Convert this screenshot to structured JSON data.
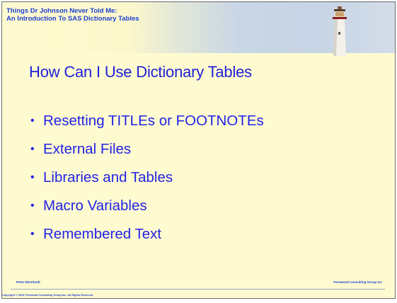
{
  "header": {
    "title_line1": "Things Dr Johnson Never Told Me:",
    "title_line2": "An Introduction To SAS Dictionary Tables"
  },
  "slide": {
    "heading": "How Can I Use Dictionary Tables",
    "bullet_symbol": "•",
    "bullets": [
      "Resetting TITLEs or FOOTNOTEs",
      "External Files",
      "Libraries and Tables",
      "Macro Variables",
      "Remembered Text"
    ]
  },
  "footer": {
    "author": "Peter Eberhardt",
    "company": "Fernwood Consulting Group Inc",
    "copyright": "Copyright © 2010 Fernwood Consulting Group Inc. All Rights Reserved."
  },
  "colors": {
    "background": "#fffbd0",
    "text_blue": "#2323e6",
    "header_blue": "#1c3fd1",
    "banner_sky": "#c7d4e5"
  },
  "icons": {
    "banner_image": "lighthouse-image"
  }
}
